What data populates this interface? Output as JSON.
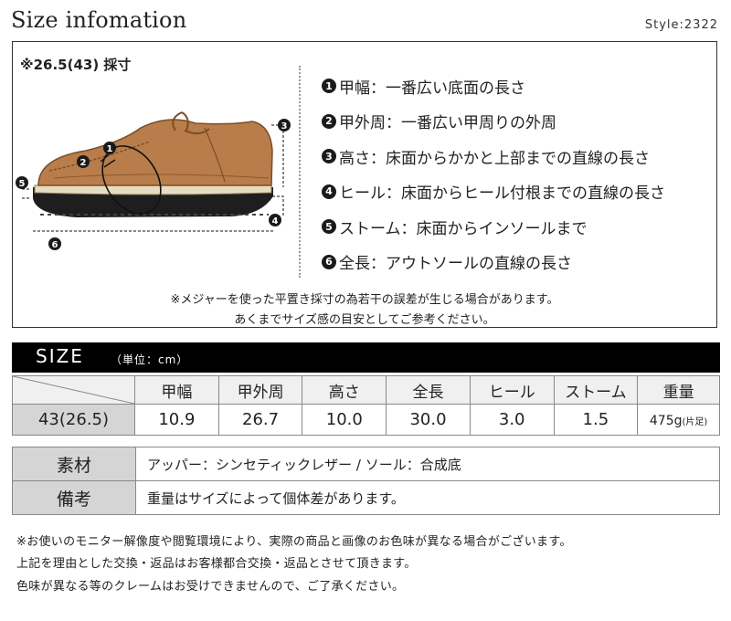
{
  "header": {
    "title": "Size infomation",
    "style": "Style:2322"
  },
  "measure": {
    "size_label": "※26.5(43) 採寸",
    "items": [
      {
        "num": "1",
        "text": "甲幅：一番広い底面の長さ"
      },
      {
        "num": "2",
        "text": "甲外周：一番広い甲周りの外周"
      },
      {
        "num": "3",
        "text": "高さ：床面からかかと上部までの直線の長さ"
      },
      {
        "num": "4",
        "text": "ヒール：床面からヒール付根までの直線の長さ"
      },
      {
        "num": "5",
        "text": "ストーム：床面からインソールまで"
      },
      {
        "num": "6",
        "text": "全長：アウトソールの直線の長さ"
      }
    ],
    "note_1": "※メジャーを使った平置き採寸の為若干の誤差が生じる場合があります。",
    "note_2": "あくまでサイズ感の目安としてご参考ください。"
  },
  "size_table": {
    "title": "SIZE",
    "unit": "（単位：cm）",
    "headers": [
      "甲幅",
      "甲外周",
      "高さ",
      "全長",
      "ヒール",
      "ストーム",
      "重量"
    ],
    "row": {
      "size": "43(26.5)",
      "values": [
        "10.9",
        "26.7",
        "10.0",
        "30.0",
        "3.0",
        "1.5"
      ],
      "weight": "475g",
      "weight_note": "(片足)"
    }
  },
  "info": {
    "material_label": "素材",
    "material_value": "アッパー：シンセティックレザー / ソール：合成底",
    "remarks_label": "備考",
    "remarks_value": "重量はサイズによって個体差があります。"
  },
  "footer": {
    "line_1": "※お使いのモニター解像度や閲覧環境により、実際の商品と画像のお色味が異なる場合がございます。",
    "line_2": "上記を理由とした交換・返品はお客様都合交換・返品とさせて頂きます。",
    "line_3": "色味が異なる等のクレームはお受けできませんので、ご了承ください。"
  },
  "colors": {
    "leather": "#b87d4b",
    "sole": "#1e1e1e",
    "bar": "#000000",
    "header_cell": "#d5d5d5"
  }
}
